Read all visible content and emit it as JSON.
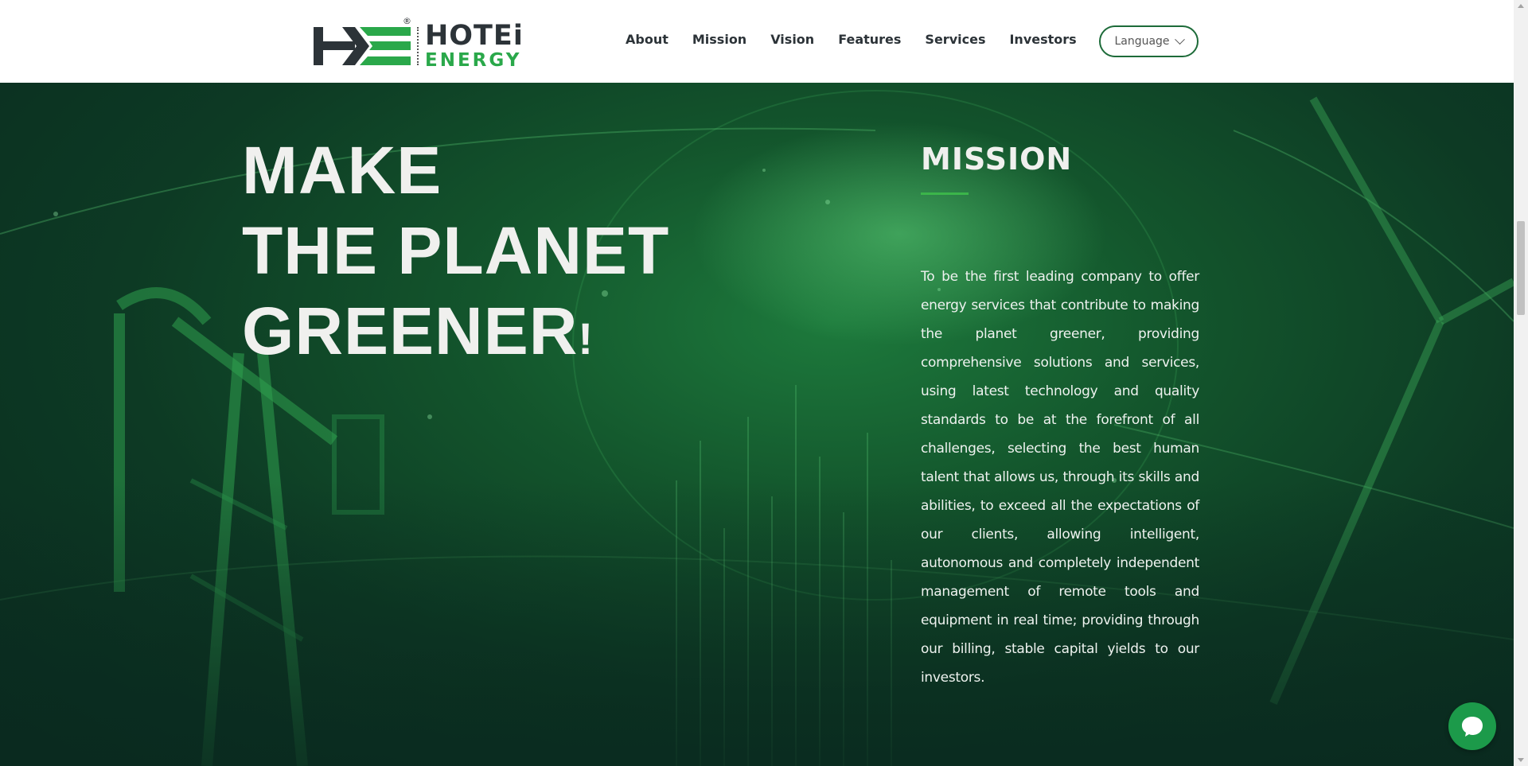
{
  "header": {
    "logo": {
      "reg_mark": "®",
      "brand_line1": "HOTEi",
      "brand_line2": "ENERGY"
    },
    "nav": [
      {
        "label": "About"
      },
      {
        "label": "Mission"
      },
      {
        "label": "Vision"
      },
      {
        "label": "Features"
      },
      {
        "label": "Services"
      },
      {
        "label": "Investors"
      }
    ],
    "language_button": {
      "label": "Language",
      "icon": "chevron-down-icon"
    }
  },
  "hero": {
    "headline": {
      "line1": "MAKE",
      "line2": "THE PLANET",
      "line3": "GREENER",
      "line3_suffix": "!"
    },
    "mission": {
      "title": "MISSION",
      "body": "To be the first leading company to offer energy services that contribute to making the planet greener, providing comprehensive solutions and services, using latest technology and quality standards to be at the forefront of all challenges, selecting the best human talent that allows us, through its skills and abilities, to exceed all the expectations of our clients, allowing intelligent, autonomous and completely independent management of remote tools and equipment in real time; providing through our billing, stable capital yields to our investors."
    }
  },
  "chat": {
    "icon": "chat-bubble-icon"
  },
  "colors": {
    "brand_green": "#2aa84a",
    "brand_dark": "#2c3338",
    "hero_bg": "#0d3a24",
    "accent_rule": "#3bb54a",
    "chat_button": "#1c9a4a"
  }
}
